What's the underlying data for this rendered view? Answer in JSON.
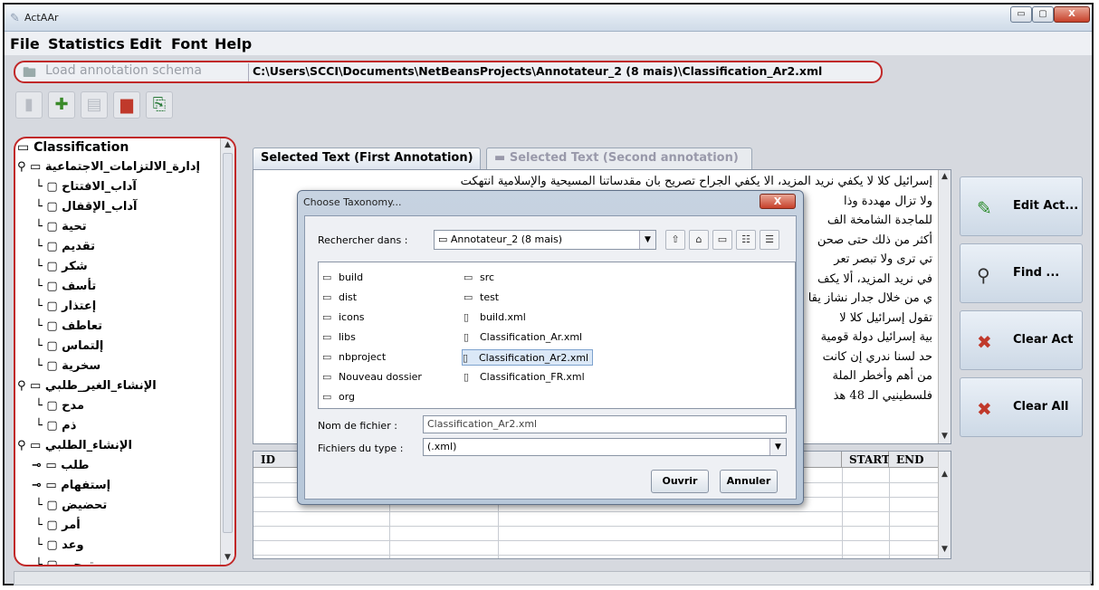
{
  "window": {
    "title": "ActAAr",
    "controls": {
      "minimize": "▭",
      "maximize": "▢",
      "close": "X"
    }
  },
  "menubar": {
    "items": [
      "File",
      "Statistics",
      "Edit",
      "Font",
      "Help"
    ]
  },
  "schema": {
    "load_label": "Load annotation schema",
    "path": "C:\\Users\\SCCI\\Documents\\NetBeansProjects\\Annotateur_2 (8 mais)\\Classification_Ar2.xml"
  },
  "toolbar": {
    "buttons": [
      "open-icon",
      "add-icon",
      "document-icon",
      "chart-icon",
      "xml-icon"
    ]
  },
  "tree": {
    "root": "Classification",
    "nodes": [
      {
        "label": "إدارة_الالتزامات_الاجتماعية",
        "level": 1
      },
      {
        "label": "آداب_الافتتاح",
        "level": 2
      },
      {
        "label": "آداب_الإقفال",
        "level": 2
      },
      {
        "label": "تحية",
        "level": 2
      },
      {
        "label": "تقديم",
        "level": 2
      },
      {
        "label": "شكر",
        "level": 2
      },
      {
        "label": "تأسف",
        "level": 2
      },
      {
        "label": "إعتذار",
        "level": 2
      },
      {
        "label": "تعاطف",
        "level": 2
      },
      {
        "label": "إلتماس",
        "level": 2
      },
      {
        "label": "سخرية",
        "level": 2
      },
      {
        "label": "الإنشاء_الغير_طلبي",
        "level": 1
      },
      {
        "label": "مدح",
        "level": 2
      },
      {
        "label": "ذم",
        "level": 2
      },
      {
        "label": "الإنشاء_الطلبي",
        "level": 1
      },
      {
        "label": "طلب",
        "level": 2
      },
      {
        "label": "إستفهام",
        "level": 2
      },
      {
        "label": "تحضيض",
        "level": 2
      },
      {
        "label": "أمر",
        "level": 2
      },
      {
        "label": "وعد",
        "level": 2
      },
      {
        "label": "ترجي",
        "level": 2
      }
    ]
  },
  "tabs": {
    "first": "Selected Text (First Annotation)",
    "second": "Selected Text (Second annotation)"
  },
  "text_lines": [
    "إسرائيل كلا لا يكفي نريد المزيد، الا يكفي الجراح تصريح بان مقدساتنا المسيحية والإسلامية انتهكت",
    "ولا تزال مهددة وذا",
    "للماجدة الشامخة الف",
    "أكثر من ذلك حتى صحن",
    "تي ترى ولا تبصر تعر",
    "في نريد المزيد، ألا يكف",
    "ي من خلال جدار نشاز يقا",
    "تقول إسرائيل كلا لا",
    "بية إسرائيل دولة قومية",
    "حد لسنا ندري إن كانت",
    "من أهم وأخطر الملة",
    "فلسطينيي الـ 48 هذ"
  ],
  "side_buttons": [
    {
      "label": "Edit Act...",
      "icon": "pencil-icon"
    },
    {
      "label": "Find ...",
      "icon": "magnifier-icon"
    },
    {
      "label": "Clear Act",
      "icon": "broom-icon"
    },
    {
      "label": "Clear All",
      "icon": "page-x-icon"
    }
  ],
  "table": {
    "columns": [
      "ID",
      "START",
      "END"
    ],
    "rows": []
  },
  "dialog": {
    "title": "Choose Taxonomy...",
    "look_in_label": "Rechercher dans :",
    "look_in_value": "Annotateur_2 (8 mais)",
    "files": [
      {
        "name": "build",
        "type": "folder"
      },
      {
        "name": "dist",
        "type": "folder"
      },
      {
        "name": "icons",
        "type": "folder"
      },
      {
        "name": "libs",
        "type": "folder"
      },
      {
        "name": "nbproject",
        "type": "folder"
      },
      {
        "name": "Nouveau dossier",
        "type": "folder"
      },
      {
        "name": "org",
        "type": "folder"
      },
      {
        "name": "src",
        "type": "folder"
      },
      {
        "name": "test",
        "type": "folder"
      },
      {
        "name": "build.xml",
        "type": "file"
      },
      {
        "name": "Classification_Ar.xml",
        "type": "file"
      },
      {
        "name": "Classification_Ar2.xml",
        "type": "file",
        "selected": true
      },
      {
        "name": "Classification_FR.xml",
        "type": "file"
      }
    ],
    "filename_label": "Nom de fichier :",
    "filename_value": "Classification_Ar2.xml",
    "filetype_label": "Fichiers du type :",
    "filetype_value": "(.xml)",
    "open_label": "Ouvrir",
    "cancel_label": "Annuler",
    "close_label": "X"
  }
}
